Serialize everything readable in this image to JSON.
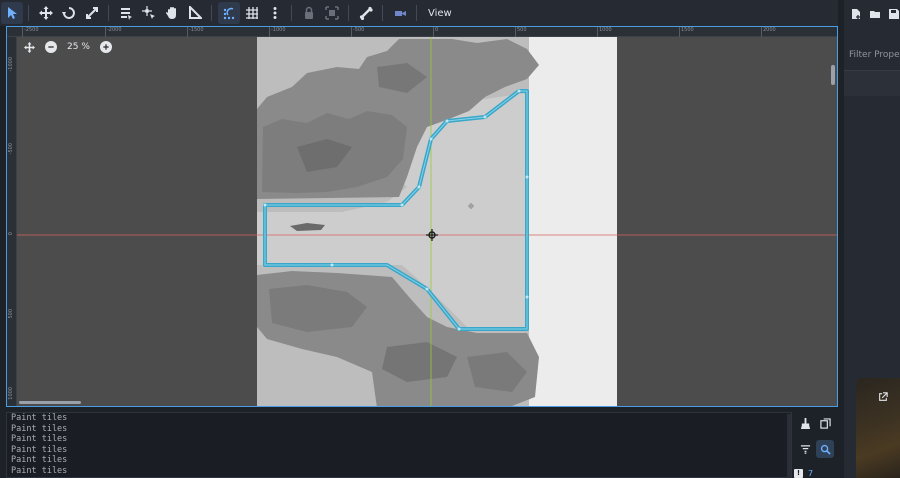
{
  "toolbar": {
    "buttons": [
      {
        "name": "select-tool",
        "icon": "cursor-arrow-icon",
        "active": true
      },
      {
        "name": "move-tool",
        "icon": "move-arrows-icon"
      },
      {
        "name": "rotate-tool",
        "icon": "rotate-icon"
      },
      {
        "name": "scale-tool",
        "icon": "scale-icon"
      },
      {
        "name": "list-select-tool",
        "icon": "list-select-icon"
      },
      {
        "name": "pivot-tool",
        "icon": "pivot-icon"
      },
      {
        "name": "pan-tool",
        "icon": "hand-icon"
      },
      {
        "name": "ruler-tool",
        "icon": "ruler-icon"
      },
      {
        "name": "smart-snap-toggle",
        "icon": "snap-icon",
        "active": true
      },
      {
        "name": "grid-snap-toggle",
        "icon": "grid-icon"
      },
      {
        "name": "snap-options",
        "icon": "kebab-menu-icon"
      },
      {
        "name": "lock-button",
        "icon": "lock-icon"
      },
      {
        "name": "group-button",
        "icon": "group-icon"
      },
      {
        "name": "skeleton-button",
        "icon": "bone-icon"
      },
      {
        "name": "camera-button",
        "icon": "camera-icon"
      }
    ],
    "view_menu": "View"
  },
  "viewport": {
    "zoom": "25 %",
    "ruler_top": [
      "-2500",
      "-2000",
      "-1500",
      "-1000",
      "-500",
      "0",
      "500",
      "1000",
      "1500",
      "2000"
    ],
    "ruler_left": [
      "-1000",
      "-500",
      "0",
      "500",
      "1000"
    ]
  },
  "inspector": {
    "filter_placeholder": "Filter Properties"
  },
  "output": {
    "lines": [
      "Paint tiles",
      "Paint tiles",
      "Paint tiles",
      "Paint tiles",
      "Paint tiles",
      "Paint tiles"
    ],
    "error_count": "7"
  },
  "colors": {
    "accent": "#4a9de2",
    "collision_outline": "#3aa6c8",
    "axis_x": "#d9605e",
    "axis_y": "#9ac83a",
    "ground": "#c9c9c9",
    "trees": "#8a8a8a"
  }
}
